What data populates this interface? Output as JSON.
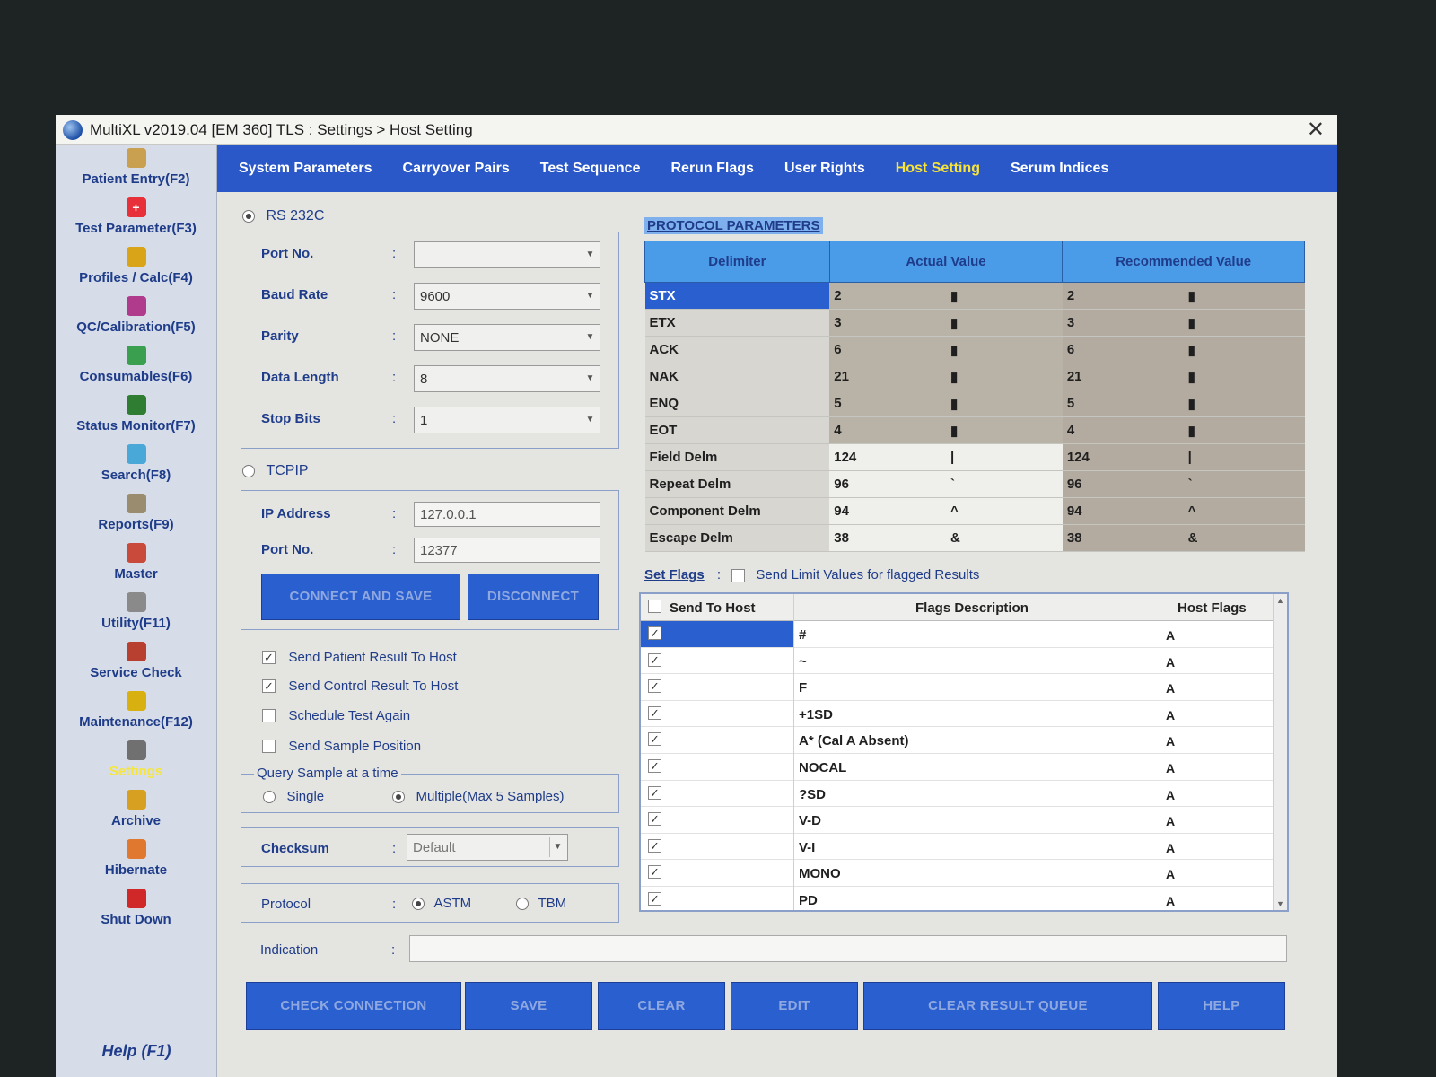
{
  "window": {
    "title": "MultiXL v2019.04 [EM 360] TLS : Settings > Host Setting",
    "close_label": "✕"
  },
  "sidebar": {
    "items": [
      {
        "label": "Patient Entry(F2)",
        "icon": "patient-icon",
        "color": "#c8a050"
      },
      {
        "label": "Test Parameter(F3)",
        "icon": "plus-icon",
        "color": "#e8303a"
      },
      {
        "label": "Profiles / Calc(F4)",
        "icon": "profiles-icon",
        "color": "#d9a418"
      },
      {
        "label": "QC/Calibration(F5)",
        "icon": "chart-icon",
        "color": "#b03a8c"
      },
      {
        "label": "Consumables(F6)",
        "icon": "consumables-icon",
        "color": "#3aa050"
      },
      {
        "label": "Status Monitor(F7)",
        "icon": "monitor-icon",
        "color": "#2e7d32"
      },
      {
        "label": "Search(F8)",
        "icon": "search-icon",
        "color": "#4aa8d8"
      },
      {
        "label": "Reports(F9)",
        "icon": "reports-icon",
        "color": "#9a8c6e"
      },
      {
        "label": "Master",
        "icon": "master-icon",
        "color": "#c94a3a"
      },
      {
        "label": "Utility(F11)",
        "icon": "utility-icon",
        "color": "#8a8a8a"
      },
      {
        "label": "Service Check",
        "icon": "service-icon",
        "color": "#b84030"
      },
      {
        "label": "Maintenance(F12)",
        "icon": "hazard-icon",
        "color": "#d8b010"
      },
      {
        "label": "Settings",
        "icon": "settings-icon",
        "color": "#707070",
        "active": true
      },
      {
        "label": "Archive",
        "icon": "archive-icon",
        "color": "#d8a020"
      },
      {
        "label": "Hibernate",
        "icon": "hibernate-icon",
        "color": "#e07830"
      },
      {
        "label": "Shut Down",
        "icon": "stop-icon",
        "color": "#d02828"
      }
    ],
    "help_label": "Help (F1)"
  },
  "tabs": [
    {
      "label": "System Parameters"
    },
    {
      "label": "Carryover Pairs"
    },
    {
      "label": "Test Sequence"
    },
    {
      "label": "Rerun Flags"
    },
    {
      "label": "User Rights"
    },
    {
      "label": "Host Setting",
      "active": true
    },
    {
      "label": "Serum Indices"
    }
  ],
  "connection": {
    "rs232_label": "RS 232C",
    "rs232_selected": true,
    "port_label": "Port No.",
    "port_value": "",
    "baud_label": "Baud Rate",
    "baud_value": "9600",
    "parity_label": "Parity",
    "parity_value": "NONE",
    "datalen_label": "Data Length",
    "datalen_value": "8",
    "stopbits_label": "Stop Bits",
    "stopbits_value": "1",
    "tcpip_label": "TCPIP",
    "ip_label": "IP Address",
    "ip_value": "127.0.0.1",
    "tcp_port_label": "Port No.",
    "tcp_port_value": "12377",
    "connect_label": "CONNECT AND SAVE",
    "disconnect_label": "DISCONNECT",
    "colon": ":"
  },
  "options": {
    "send_patient": "Send Patient Result To Host",
    "send_control": "Send Control Result To Host",
    "schedule_again": "Schedule Test Again",
    "send_position": "Send Sample Position",
    "query_title": "Query Sample at a time",
    "single_label": "Single",
    "multiple_label": "Multiple(Max 5 Samples)",
    "checksum_label": "Checksum",
    "checksum_value": "Default",
    "protocol_label": "Protocol",
    "astm_label": "ASTM",
    "tbm_label": "TBM",
    "indication_label": "Indication",
    "indication_value": ""
  },
  "protocol": {
    "title": "PROTOCOL PARAMETERS",
    "headers": {
      "delimiter": "Delimiter",
      "actual": "Actual Value",
      "recommended": "Recommended Value"
    },
    "rows": [
      {
        "name": "STX",
        "actual": "2",
        "actual_glyph": "▮",
        "rec": "2",
        "rec_glyph": "▮"
      },
      {
        "name": "ETX",
        "actual": "3",
        "actual_glyph": "▮",
        "rec": "3",
        "rec_glyph": "▮"
      },
      {
        "name": "ACK",
        "actual": "6",
        "actual_glyph": "▮",
        "rec": "6",
        "rec_glyph": "▮"
      },
      {
        "name": "NAK",
        "actual": "21",
        "actual_glyph": "▮",
        "rec": "21",
        "rec_glyph": "▮"
      },
      {
        "name": "ENQ",
        "actual": "5",
        "actual_glyph": "▮",
        "rec": "5",
        "rec_glyph": "▮"
      },
      {
        "name": "EOT",
        "actual": "4",
        "actual_glyph": "▮",
        "rec": "4",
        "rec_glyph": "▮"
      },
      {
        "name": "Field Delm",
        "actual": "124",
        "actual_glyph": "|",
        "rec": "124",
        "rec_glyph": "|"
      },
      {
        "name": "Repeat Delm",
        "actual": "96",
        "actual_glyph": "`",
        "rec": "96",
        "rec_glyph": "`"
      },
      {
        "name": "Component Delm",
        "actual": "94",
        "actual_glyph": "^",
        "rec": "94",
        "rec_glyph": "^"
      },
      {
        "name": "Escape Delm",
        "actual": "38",
        "actual_glyph": "&",
        "rec": "38",
        "rec_glyph": "&"
      }
    ]
  },
  "flags": {
    "set_flags_label": "Set Flags",
    "limit_label": "Send Limit Values for flagged Results",
    "headers": {
      "send": "Send To Host",
      "desc": "Flags Description",
      "host": "Host Flags"
    },
    "rows": [
      {
        "desc": "#",
        "host": "A"
      },
      {
        "desc": "~",
        "host": "A"
      },
      {
        "desc": "F",
        "host": "A"
      },
      {
        "desc": "+1SD",
        "host": "A"
      },
      {
        "desc": "A* (Cal A Absent)",
        "host": "A"
      },
      {
        "desc": "NOCAL",
        "host": "A"
      },
      {
        "desc": "?SD",
        "host": "A"
      },
      {
        "desc": "V-D",
        "host": "A"
      },
      {
        "desc": "V-I",
        "host": "A"
      },
      {
        "desc": "MONO",
        "host": "A"
      },
      {
        "desc": "PD",
        "host": "A"
      }
    ]
  },
  "bottom_buttons": {
    "check": "CHECK CONNECTION",
    "save": "SAVE",
    "clear": "CLEAR",
    "edit": "EDIT",
    "clear_queue": "CLEAR RESULT QUEUE",
    "help": "HELP"
  },
  "colors": {
    "accent_blue": "#2a58c8",
    "active_tab": "#f7e33a",
    "label_blue": "#1f3c8a"
  }
}
